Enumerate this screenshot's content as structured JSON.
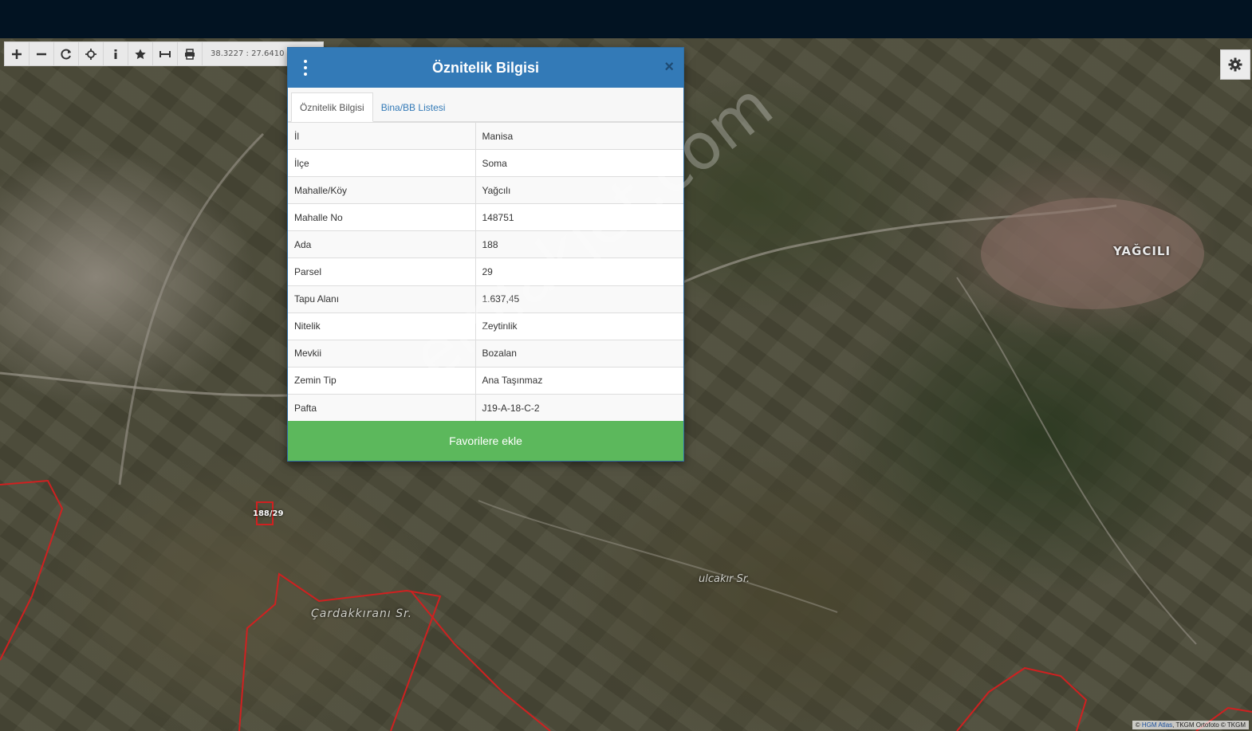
{
  "toolbar": {
    "coords": "38.3227 : 27.6410"
  },
  "map": {
    "labels": {
      "village": "YAĞCILI",
      "cardak": "Çardakkıranı Sr.",
      "ulcakir": "ulcakır Sr.",
      "parcel": "188/29"
    },
    "attribution": {
      "prefix": "©",
      "hgm": "HGM Atlas",
      "rest": ", TKGM Ortofoto © TKGM"
    }
  },
  "dialog": {
    "title": "Öznitelik Bilgisi",
    "close_label": "×",
    "tabs": [
      {
        "label": "Öznitelik Bilgisi",
        "active": true
      },
      {
        "label": "Bina/BB Listesi",
        "active": false
      }
    ],
    "rows": [
      {
        "key": "İl",
        "value": "Manisa"
      },
      {
        "key": "İlçe",
        "value": "Soma"
      },
      {
        "key": "Mahalle/Köy",
        "value": "Yağcılı"
      },
      {
        "key": "Mahalle No",
        "value": "148751"
      },
      {
        "key": "Ada",
        "value": "188"
      },
      {
        "key": "Parsel",
        "value": "29"
      },
      {
        "key": "Tapu Alanı",
        "value": "1.637,45"
      },
      {
        "key": "Nitelik",
        "value": "Zeytinlik"
      },
      {
        "key": "Mevkii",
        "value": "Bozalan"
      },
      {
        "key": "Zemin Tip",
        "value": "Ana Taşınmaz"
      },
      {
        "key": "Pafta",
        "value": "J19-A-18-C-2"
      }
    ],
    "favorite_button": "Favorilere ekle"
  },
  "watermark": "emlakjet.com",
  "colors": {
    "header": "#337ab7",
    "favorite": "#5cb85c",
    "topbar": "#021322",
    "parcel_border": "#d02020"
  }
}
